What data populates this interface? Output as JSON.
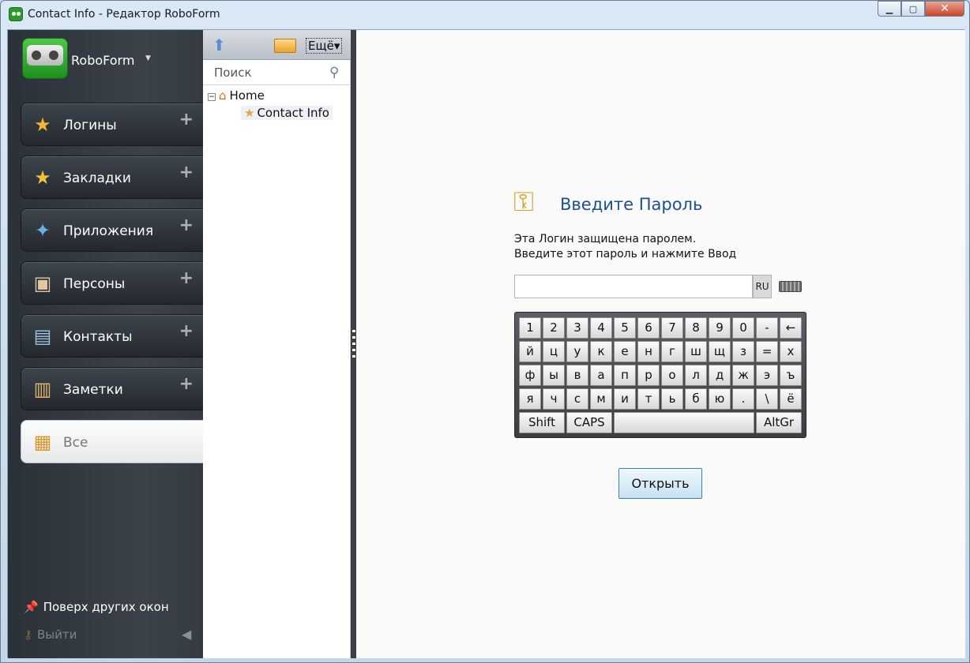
{
  "window": {
    "title": "Contact Info - Редактор RoboForm"
  },
  "sidebar": {
    "brand": "RoboForm",
    "categories": [
      {
        "label": "Логины",
        "icon": "logins-icon"
      },
      {
        "label": "Закладки",
        "icon": "bookmarks-icon"
      },
      {
        "label": "Приложения",
        "icon": "apps-icon"
      },
      {
        "label": "Персоны",
        "icon": "identities-icon"
      },
      {
        "label": "Контакты",
        "icon": "contacts-icon"
      },
      {
        "label": "Заметки",
        "icon": "notes-icon"
      },
      {
        "label": "Все",
        "icon": "all-icon"
      }
    ],
    "add_symbol": "+",
    "stay_on_top": "Поверх других окон",
    "logout": "Выйти"
  },
  "tree": {
    "more": "Ещё",
    "search_placeholder": "Поиск",
    "home": "Home",
    "item": "Contact Info"
  },
  "main": {
    "title": "Введите Пароль",
    "message_line1": "Эта Логин защищена паролем.",
    "message_line2": "Введите этот пароль и нажмите Ввод",
    "lang": "RU",
    "keyboard": [
      [
        "1",
        "2",
        "3",
        "4",
        "5",
        "6",
        "7",
        "8",
        "9",
        "0",
        "-",
        "←"
      ],
      [
        "й",
        "ц",
        "у",
        "к",
        "е",
        "н",
        "г",
        "ш",
        "щ",
        "з",
        "=",
        "х"
      ],
      [
        "ф",
        "ы",
        "в",
        "а",
        "п",
        "р",
        "о",
        "л",
        "д",
        "ж",
        "э",
        "ъ"
      ],
      [
        "я",
        "ч",
        "с",
        "м",
        "и",
        "т",
        "ь",
        "б",
        "ю",
        ".",
        "\\",
        "ё"
      ]
    ],
    "keyboard_bottom": {
      "shift": "Shift",
      "caps": "CAPS",
      "altgr": "AltGr"
    },
    "open_button": "Открыть"
  }
}
